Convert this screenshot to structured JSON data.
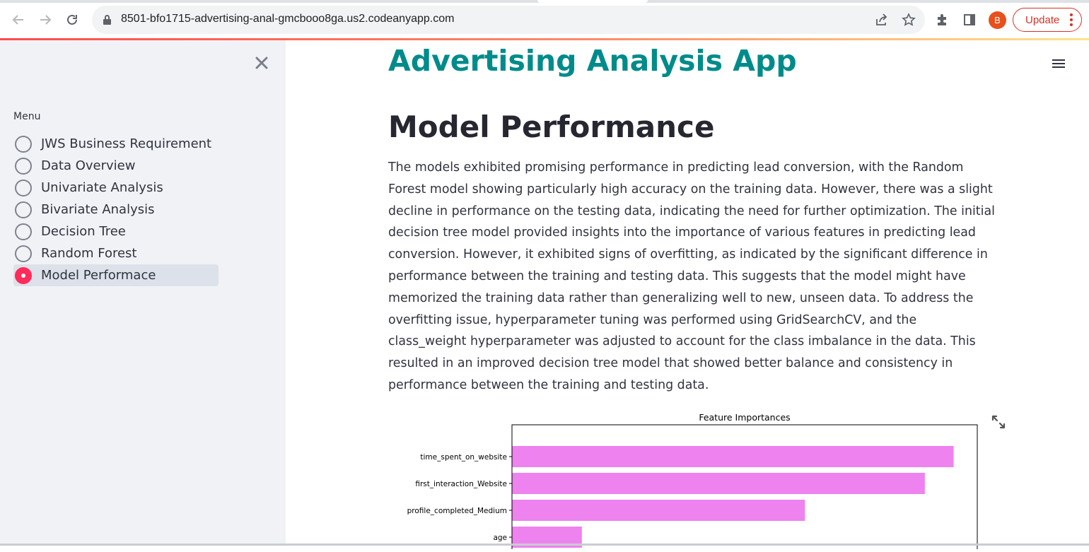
{
  "browser": {
    "url": "8501-bfo1715-advertising-anal-gmcbooo8ga.us2.codeanyapp.com",
    "avatar_letter": "B",
    "update_label": "Update",
    "icons": [
      "back-arrow-icon",
      "forward-arrow-icon",
      "reload-icon",
      "lock-icon",
      "share-icon",
      "star-icon",
      "extension-puzzle-icon",
      "side-panel-icon",
      "kebab-menu-icon"
    ]
  },
  "sidebar": {
    "menu_label": "Menu",
    "items": [
      {
        "label": "JWS Business Requirement",
        "selected": false
      },
      {
        "label": "Data Overview",
        "selected": false
      },
      {
        "label": "Univariate Analysis",
        "selected": false
      },
      {
        "label": "Bivariate Analysis",
        "selected": false
      },
      {
        "label": "Decision Tree",
        "selected": false
      },
      {
        "label": "Random Forest",
        "selected": false
      },
      {
        "label": "Model Performace",
        "selected": true
      }
    ]
  },
  "main": {
    "app_title": "Advertising Analysis App",
    "section_title": "Model Performance",
    "paragraph": "The models exhibited promising performance in predicting lead conversion, with the Random Forest model showing particularly high accuracy on the training data. However, there was a slight decline in performance on the testing data, indicating the need for further optimization. The initial decision tree model provided insights into the importance of various features in predicting lead conversion. However, it exhibited signs of overfitting, as indicated by the significant difference in performance between the training and testing data. This suggests that the model might have memorized the training data rather than generalizing well to new, unseen data. To address the overfitting issue, hyperparameter tuning was performed using GridSearchCV, and the class_weight hyperparameter was adjusted to account for the class imbalance in the data. This resulted in an improved decision tree model that showed better balance and consistency in performance between the training and testing data."
  },
  "colors": {
    "accent": "#ff2b5a",
    "title": "#008b8b",
    "bar": "#ee82ee",
    "sidebar_bg": "#f0f2f6"
  },
  "chart_data": {
    "type": "bar",
    "orientation": "horizontal",
    "title": "Feature Importances",
    "categories": [
      "time_spent_on_website",
      "first_interaction_Website",
      "profile_completed_Medium",
      "age"
    ],
    "values": [
      0.92,
      0.86,
      0.61,
      0.145
    ],
    "xlim": [
      0,
      0.97
    ],
    "color": "#ee82ee"
  }
}
